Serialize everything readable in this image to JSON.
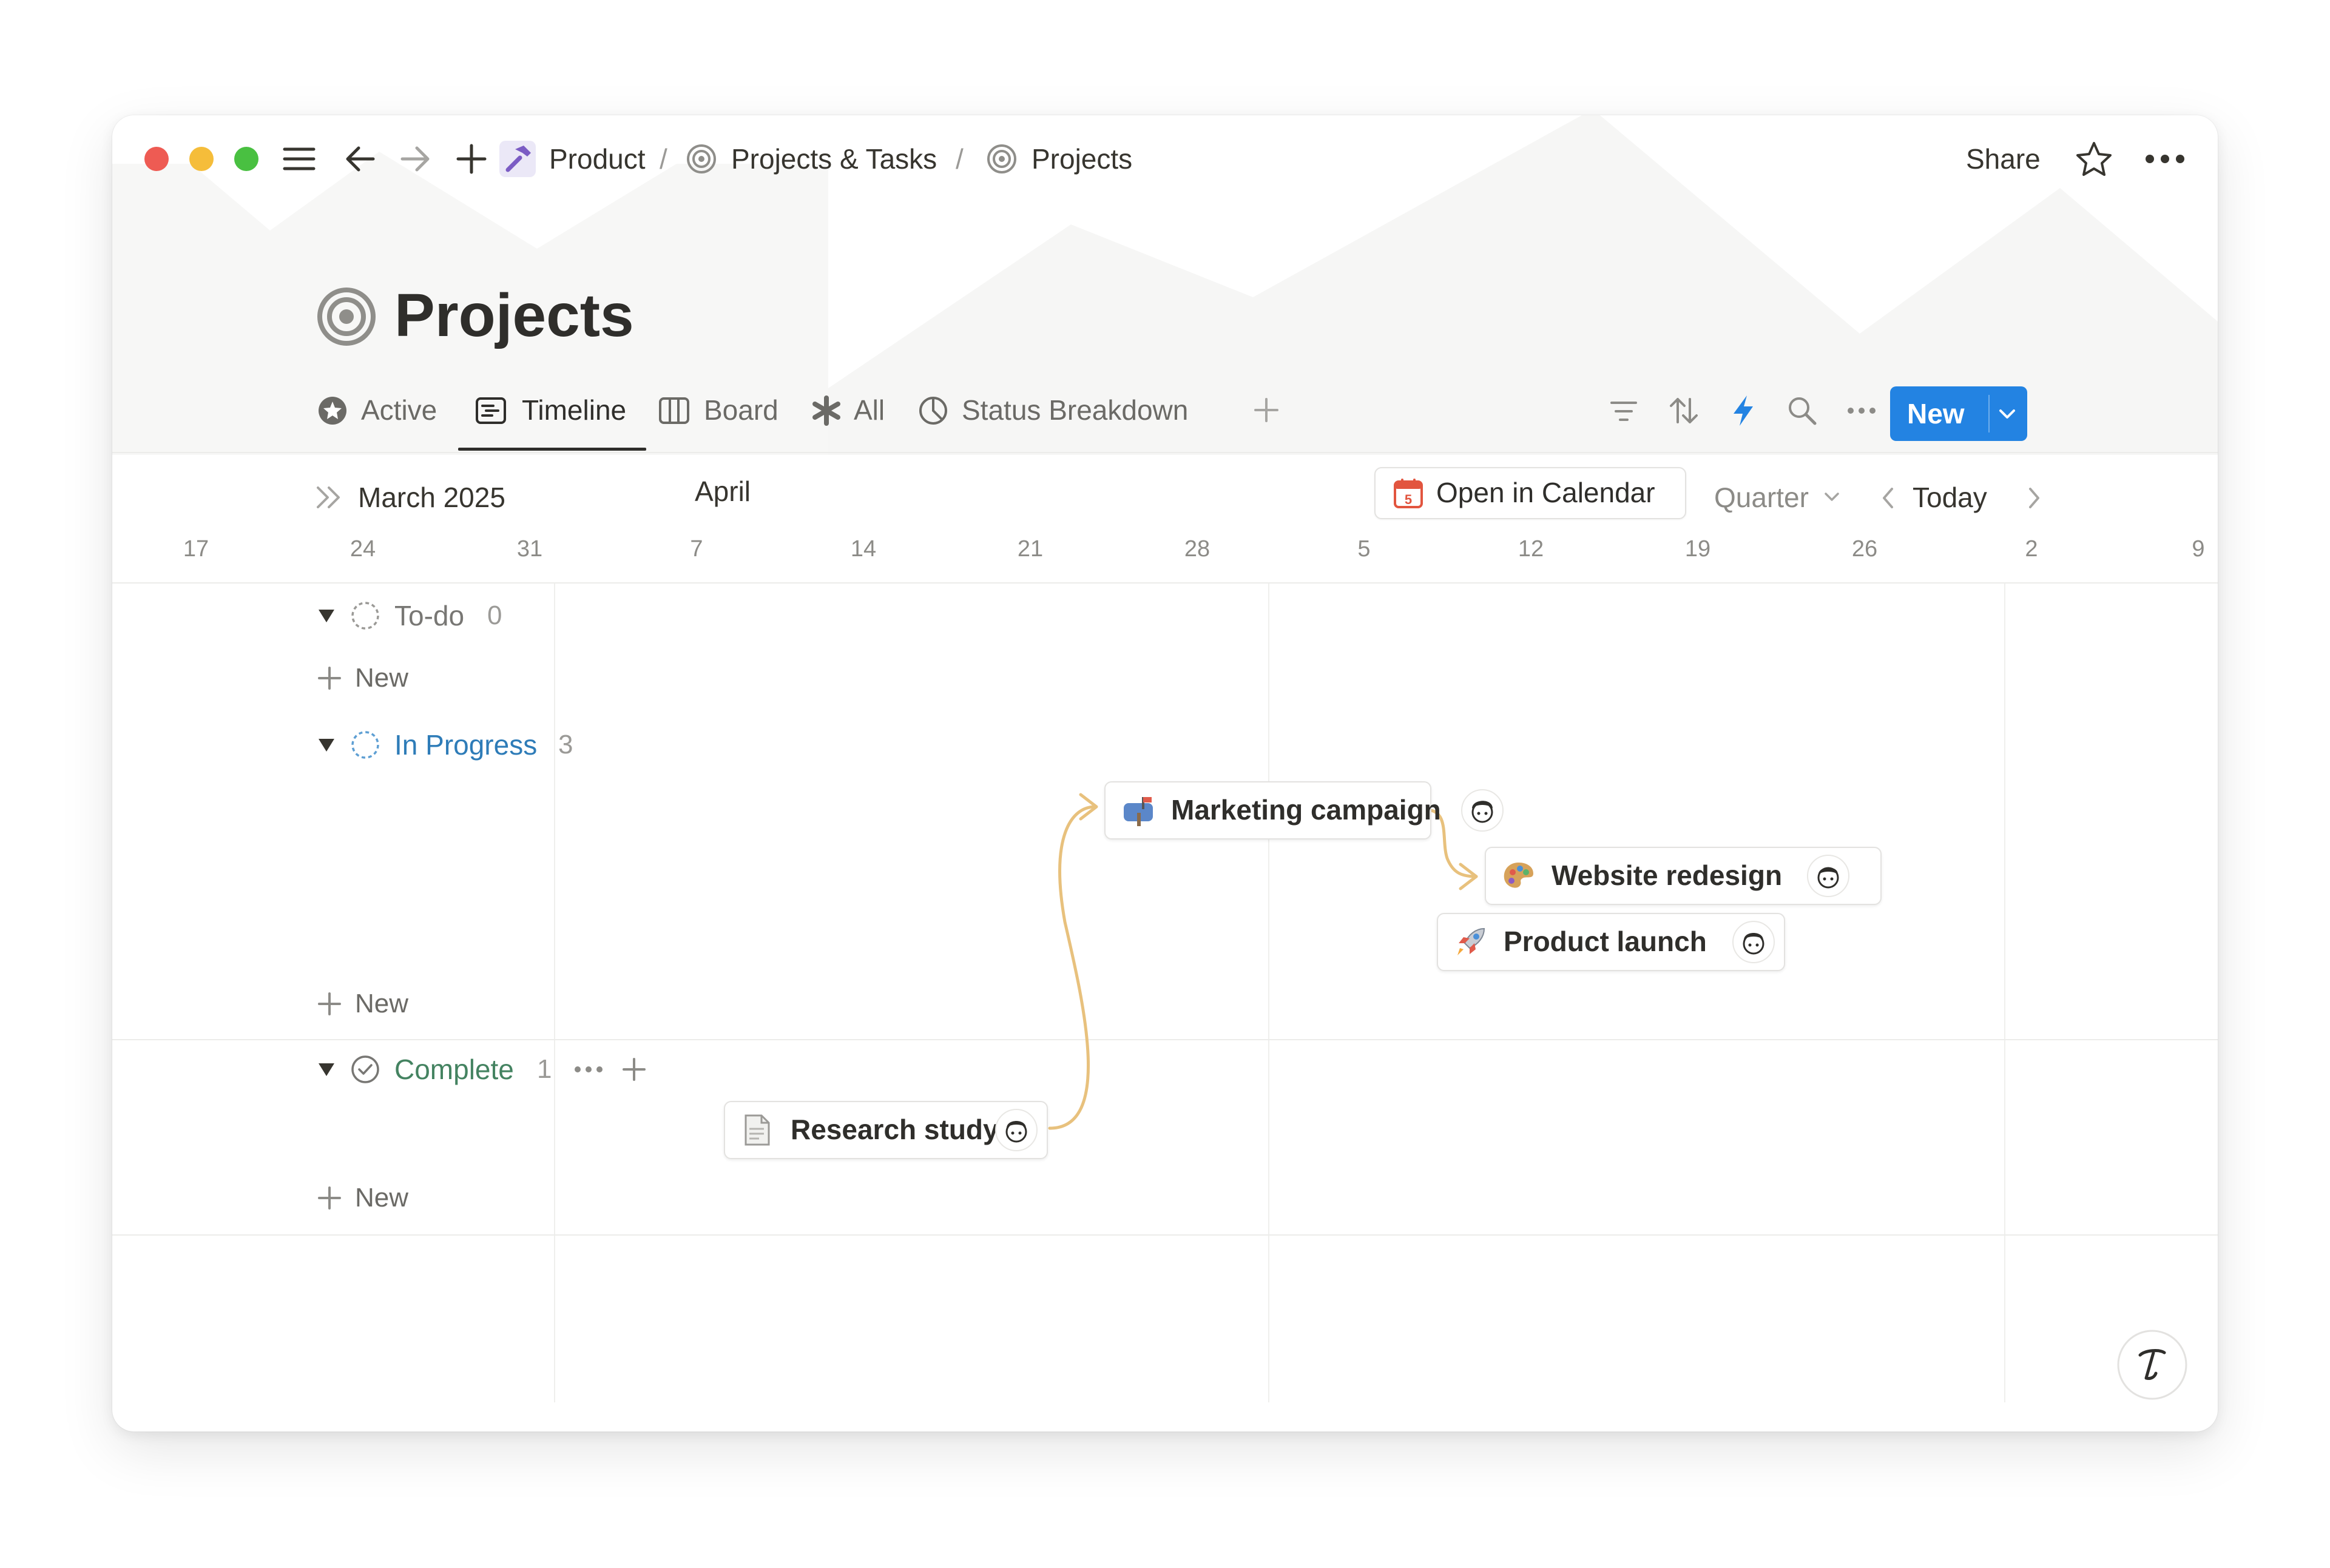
{
  "window": {
    "breadcrumb": [
      {
        "label": "Product",
        "sep": "/"
      },
      {
        "label": "Projects & Tasks",
        "sep": "/"
      },
      {
        "label": "Projects"
      }
    ],
    "share_label": "Share"
  },
  "page": {
    "title": "Projects",
    "tabs": [
      {
        "label": "Active",
        "icon": "star-badge-icon"
      },
      {
        "label": "Timeline",
        "icon": "timeline-icon",
        "active": true
      },
      {
        "label": "Board",
        "icon": "board-icon"
      },
      {
        "label": "All",
        "icon": "asterisk-icon"
      },
      {
        "label": "Status Breakdown",
        "icon": "pie-chart-icon"
      }
    ],
    "new_button_label": "New"
  },
  "timeline": {
    "month_current": "March 2025",
    "month_next": "April",
    "open_in_calendar": "Open in Calendar",
    "calendar_icon_day": "5",
    "scale": "Quarter",
    "today_label": "Today",
    "dates": [
      "17",
      "24",
      "31",
      "7",
      "14",
      "21",
      "28",
      "5",
      "12",
      "19",
      "26",
      "2",
      "9"
    ]
  },
  "groups": {
    "todo": {
      "label": "To-do",
      "count": "0",
      "color": "#787774"
    },
    "in_progress": {
      "label": "In Progress",
      "count": "3",
      "color": "#2e7cb8"
    },
    "complete": {
      "label": "Complete",
      "count": "1",
      "color": "#448361"
    },
    "add_new_label": "New"
  },
  "tasks": {
    "marketing": {
      "label": "Marketing campaign",
      "icon": "mailbox-icon"
    },
    "website": {
      "label": "Website redesign",
      "icon": "palette-icon"
    },
    "launch": {
      "label": "Product launch",
      "icon": "rocket-icon"
    },
    "research": {
      "label": "Research study",
      "icon": "document-icon"
    }
  },
  "colors": {
    "accent": "#2383e2",
    "dependency": "#e8c17d"
  }
}
